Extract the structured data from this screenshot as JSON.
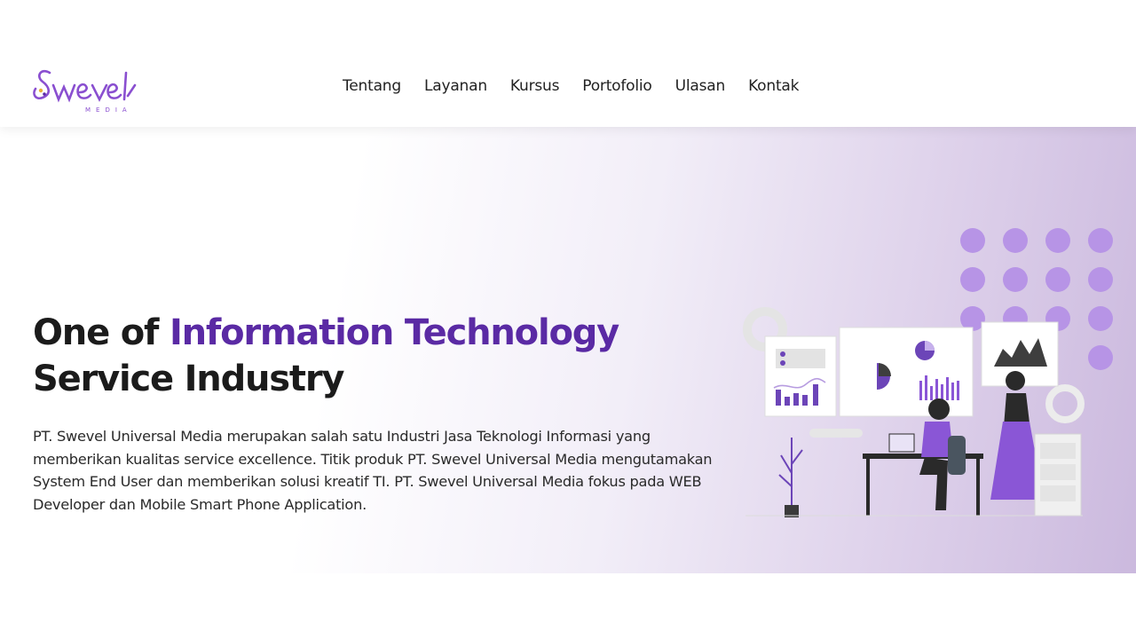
{
  "brand": {
    "logo_text": "Swevel",
    "logo_sub": "MEDIA",
    "color": "#8a4fd0"
  },
  "nav": [
    {
      "label": "Tentang"
    },
    {
      "label": "Layanan"
    },
    {
      "label": "Kursus"
    },
    {
      "label": "Portofolio"
    },
    {
      "label": "Ulasan"
    },
    {
      "label": "Kontak"
    }
  ],
  "hero": {
    "headline_prefix": "One of ",
    "headline_accent": "Information Technology",
    "headline_line2": "Service Industry",
    "description": "PT. Swevel Universal Media merupakan salah satu Industri Jasa Teknologi Informasi yang memberikan kualitas service excellence. Titik produk PT. Swevel Universal Media mengutamakan System End User dan memberikan solusi kreatif TI. PT. Swevel Universal Media fokus pada WEB Developer dan Mobile Smart Phone Application."
  },
  "colors": {
    "accent": "#5a2aa4",
    "purple_light": "#b794e6",
    "purple_mid": "#8a56d6"
  }
}
